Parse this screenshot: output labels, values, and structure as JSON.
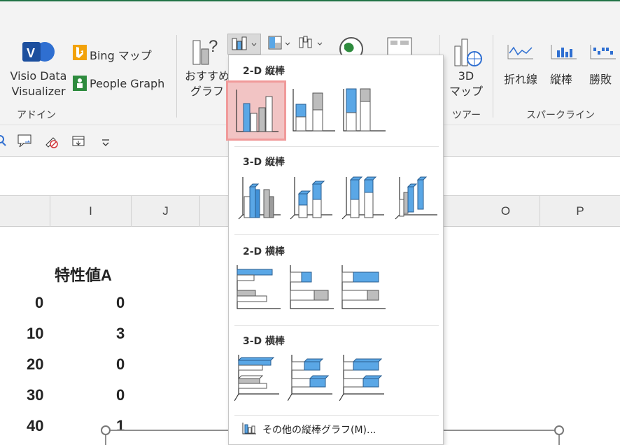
{
  "ribbon": {
    "addins": {
      "visio_label": "Visio Data\nVisualizer",
      "bing_label": "Bing マップ",
      "people_label": "People Graph",
      "group_label": "アドイン"
    },
    "recommended_label": "おすすめ\nグラフ",
    "map3d_label": "3D\nマップ",
    "tour_group": "ツアー",
    "sparklines": {
      "line": "折れ線",
      "column": "縦棒",
      "winloss": "勝敗",
      "group_label": "スパークライン"
    }
  },
  "columns": [
    "I",
    "J",
    "O",
    "P"
  ],
  "sheet": {
    "header": "特性値A",
    "rows": [
      {
        "x": "0",
        "y": "0"
      },
      {
        "x": "10",
        "y": "3"
      },
      {
        "x": "20",
        "y": "0"
      },
      {
        "x": "30",
        "y": "0"
      },
      {
        "x": "40",
        "y": "1"
      }
    ]
  },
  "dropdown": {
    "sections": [
      "2-D 縦棒",
      "3-D 縦棒",
      "2-D 横棒",
      "3-D 横棒"
    ],
    "more_label": "その他の縦棒グラフ(M)..."
  },
  "colors": {
    "accent": "#5aa7e6",
    "highlight": "#f2c4c4",
    "excel_green": "#217346"
  }
}
